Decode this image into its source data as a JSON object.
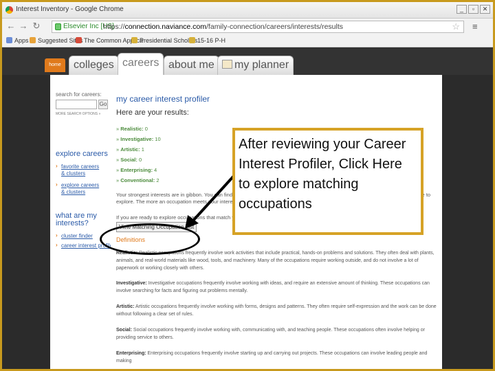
{
  "browser": {
    "window_title": "Interest Inventory - Google Chrome",
    "secure_label": "Elsevier Inc [US]",
    "url_scheme": "https://",
    "url_host": "connection.naviance.com",
    "url_path": "/family-connection/careers/interests/results",
    "bookmarks": [
      "Apps",
      "Suggested Sites",
      "The Common Applica",
      "Presidential Scholars",
      "15-16 P-H"
    ]
  },
  "site": {
    "home_tab": "home",
    "tabs": [
      "colleges",
      "careers",
      "about me",
      "my planner"
    ],
    "active_tab": "careers"
  },
  "sidebar": {
    "search_label": "search for careers:",
    "go_label": "Go",
    "more_options": "MORE SEARCH OPTIONS »",
    "explore_heading": "explore careers",
    "explore_links": [
      "favorite careers & clusters",
      "explore careers & clusters"
    ],
    "interests_heading": "what are my interests?",
    "interests_links": [
      "cluster finder",
      "career interest profiler"
    ]
  },
  "main": {
    "title": "my career interest profiler",
    "subtitle": "Here are your results:",
    "scores": [
      {
        "label": "Realistic:",
        "value": "0"
      },
      {
        "label": "Investigative:",
        "value": "10"
      },
      {
        "label": "Artistic:",
        "value": "1"
      },
      {
        "label": "Social:",
        "value": "0"
      },
      {
        "label": "Enterprising:",
        "value": "4"
      },
      {
        "label": "Conventional:",
        "value": "2"
      }
    ],
    "strongest_text": "Your strongest interests are in gibbon. You can find out about occupations that match your interests. Careers that interest you might like to explore. The more an occupation meets your interests, the more likely you",
    "ready_text": "If you are ready to explore occupations that match your interests,",
    "matching_button": "View Matching Occupation List",
    "definitions_heading": "Definitions",
    "definitions": [
      {
        "term": "Realistic:",
        "text": "Realistic occupations frequently involve work activities that include practical, hands-on problems and solutions. They often deal with plants, animals, and real-world materials like wood, tools, and machinery. Many of the occupations require working outside, and do not involve a lot of paperwork or working closely with others."
      },
      {
        "term": "Investigative:",
        "text": "Investigative occupations frequently involve working with ideas, and require an extensive amount of thinking. These occupations can involve searching for facts and figuring out problems mentally."
      },
      {
        "term": "Artistic:",
        "text": "Artistic occupations frequently involve working with forms, designs and patterns. They often require self-expression and the work can be done without following a clear set of rules."
      },
      {
        "term": "Social:",
        "text": "Social occupations frequently involve working with, communicating with, and teaching people. These occupations often involve helping or providing service to others."
      },
      {
        "term": "Enterprising:",
        "text": "Enterprising occupations frequently involve starting up and carrying out projects. These occupations can involve leading people and making"
      }
    ]
  },
  "callout": {
    "text": "After reviewing your Career Interest Profiler, Click Here to explore matching occupations"
  }
}
